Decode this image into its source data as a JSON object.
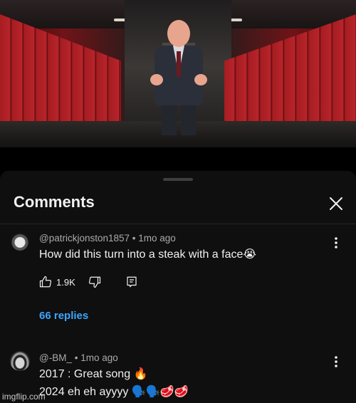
{
  "video": {
    "icons": [
      "hallway-scene"
    ]
  },
  "comments_panel": {
    "title": "Comments",
    "close_icon": "close-icon",
    "comments": [
      {
        "author": "@patrickjonston1857",
        "age": "1mo ago",
        "text": "How did this turn into a steak with a face😭",
        "likes": "1.9K",
        "replies_label": "66 replies"
      },
      {
        "author": "@-BM_",
        "age": "1mo ago",
        "line1": "2017 : Great song 🔥",
        "line2": "2024 eh eh ayyyy 🗣️🗣️🥩🥩"
      }
    ]
  },
  "watermark": "imgflip.com",
  "colors": {
    "background": "#0f0f0f",
    "link": "#3ea6ff",
    "meta": "#aaaaaa"
  }
}
